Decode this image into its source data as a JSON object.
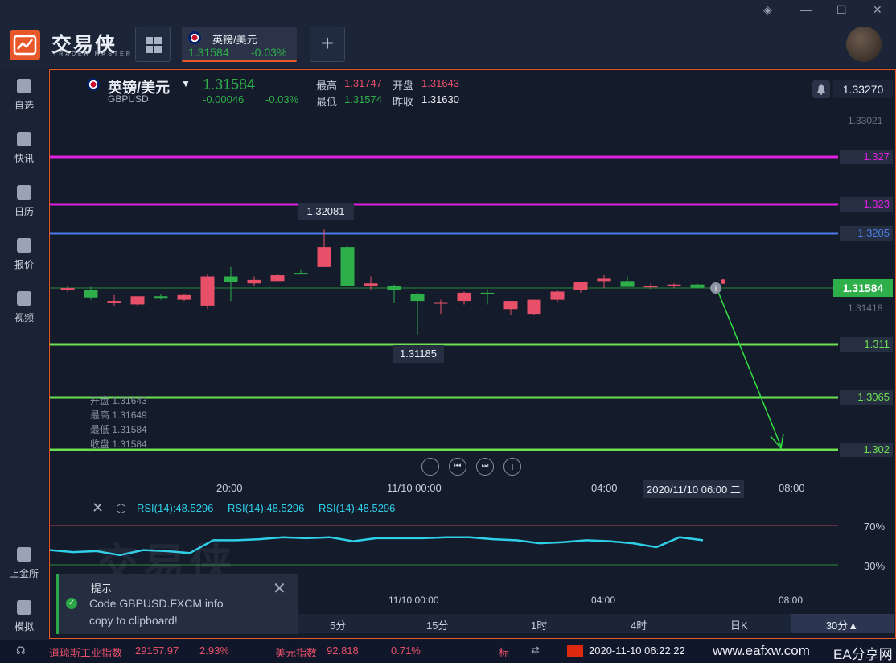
{
  "app": {
    "name": "交易侠",
    "sub": "TRADER MASTER"
  },
  "tab": {
    "symbol": "英镑/美元",
    "price": "1.31584",
    "change": "-0.03%"
  },
  "sidebar": [
    {
      "label": "自选",
      "icon": "bookmark-icon"
    },
    {
      "label": "快讯",
      "icon": "news-icon"
    },
    {
      "label": "日历",
      "icon": "calendar-icon"
    },
    {
      "label": "报价",
      "icon": "quote-chart-icon"
    },
    {
      "label": "视频",
      "icon": "video-icon"
    },
    {
      "label": "上金所",
      "icon": "exchange-icon"
    },
    {
      "label": "模拟",
      "icon": "wallet-icon"
    }
  ],
  "quote": {
    "symbol": "英镑/美元",
    "code": "GBPUSD",
    "last": "1.31584",
    "chg": "-0.00046",
    "pct": "-0.03%",
    "high_label": "最高",
    "high": "1.31747",
    "open_label": "开盘",
    "open": "1.31643",
    "low_label": "最低",
    "low": "1.31574",
    "prev_label": "昨收",
    "prev": "1.31630",
    "alert_price": "1.33270"
  },
  "price_labels": {
    "p1": "1.33021",
    "p2": "1.327",
    "p3": "1.323",
    "p4": "1.3205",
    "p5": "1.31584",
    "p6": "1.31418",
    "p7": "1.311",
    "p8": "1.3065",
    "p9": "1.302",
    "hi_marker": "1.32081",
    "lo_marker": "1.31185"
  },
  "ohlc_box": [
    "开盘 1.31643",
    "最高 1.31649",
    "最低 1.31584",
    "收盘 1.31584"
  ],
  "time_axis": [
    "20:00",
    "11/10 00:00",
    "04:00",
    "2020/11/10 06:00 二",
    "08:00"
  ],
  "rsi_labels": [
    "RSI(14):48.5296",
    "RSI(14):48.5296",
    "RSI(14):48.5296"
  ],
  "rsi_levels": {
    "top": "70%",
    "bottom": "30%"
  },
  "rsi_time_axis": [
    "11/10 00:00",
    "04:00",
    "08:00"
  ],
  "timeframes": [
    "5分",
    "15分",
    "1时",
    "4时",
    "日K",
    "30分▲"
  ],
  "toast": {
    "title": "提示",
    "msg1": "Code GBPUSD.FXCM info",
    "msg2": "copy to clipboard!"
  },
  "status": {
    "idx1_name": "道琼斯工业指数",
    "idx1_val": "29157.97",
    "idx1_pct": "2.93%",
    "idx2_name": "美元指数",
    "idx2_val": "92.818",
    "idx2_pct": "0.71%",
    "idx3_name": "标",
    "datetime": "2020-11-10 06:22:22",
    "watermark": "www.eafxw.com",
    "watermark2": "EA分享网"
  },
  "candles": [
    [
      1.3157,
      1.316,
      1.31545,
      1.3158
    ],
    [
      1.3156,
      1.3159,
      1.3148,
      1.315
    ],
    [
      1.3145,
      1.3152,
      1.3143,
      1.3147
    ],
    [
      1.3144,
      1.3151,
      1.3143,
      1.3151
    ],
    [
      1.3151,
      1.3153,
      1.3148,
      1.315
    ],
    [
      1.3148,
      1.3153,
      1.3147,
      1.3152
    ],
    [
      1.3143,
      1.317,
      1.314,
      1.3168
    ],
    [
      1.3168,
      1.3176,
      1.3147,
      1.3163
    ],
    [
      1.3162,
      1.3168,
      1.316,
      1.3165
    ],
    [
      1.3164,
      1.317,
      1.3163,
      1.3169
    ],
    [
      1.3171,
      1.3174,
      1.317,
      1.317
    ],
    [
      1.3176,
      1.32081,
      1.3176,
      1.3193
    ],
    [
      1.3193,
      1.3194,
      1.316,
      1.316
    ],
    [
      1.316,
      1.3168,
      1.3156,
      1.3162
    ],
    [
      1.316,
      1.3161,
      1.3145,
      1.3156
    ],
    [
      1.3153,
      1.3154,
      1.31185,
      1.3147
    ],
    [
      1.3146,
      1.3148,
      1.3136,
      1.3146
    ],
    [
      1.3147,
      1.3155,
      1.3144,
      1.3154
    ],
    [
      1.3154,
      1.3157,
      1.3144,
      1.3153
    ],
    [
      1.314,
      1.3147,
      1.3135,
      1.3147
    ],
    [
      1.3136,
      1.3148,
      1.3135,
      1.3148
    ],
    [
      1.3148,
      1.3156,
      1.3146,
      1.3155
    ],
    [
      1.3156,
      1.3163,
      1.3154,
      1.3163
    ],
    [
      1.3164,
      1.3169,
      1.3158,
      1.3166
    ],
    [
      1.3164,
      1.3168,
      1.3159,
      1.3159
    ],
    [
      1.3159,
      1.3162,
      1.3157,
      1.316
    ],
    [
      1.316,
      1.3162,
      1.3158,
      1.3161
    ],
    [
      1.3161,
      1.3162,
      1.31575,
      1.31584
    ]
  ],
  "rsi": [
    45,
    43,
    44,
    40,
    45,
    44,
    42,
    55,
    55,
    56,
    58,
    57,
    58,
    54,
    57,
    57,
    57,
    58,
    58,
    56,
    55,
    52,
    53,
    55,
    54,
    52,
    48,
    58,
    55
  ],
  "colors": {
    "up": "#e8506a",
    "down": "#2eaf4a",
    "magenta": "#e020e0",
    "blue": "#4a7ae8",
    "green": "#6be050",
    "rsi": "#2ed0e8",
    "accent": "#e8572a"
  }
}
